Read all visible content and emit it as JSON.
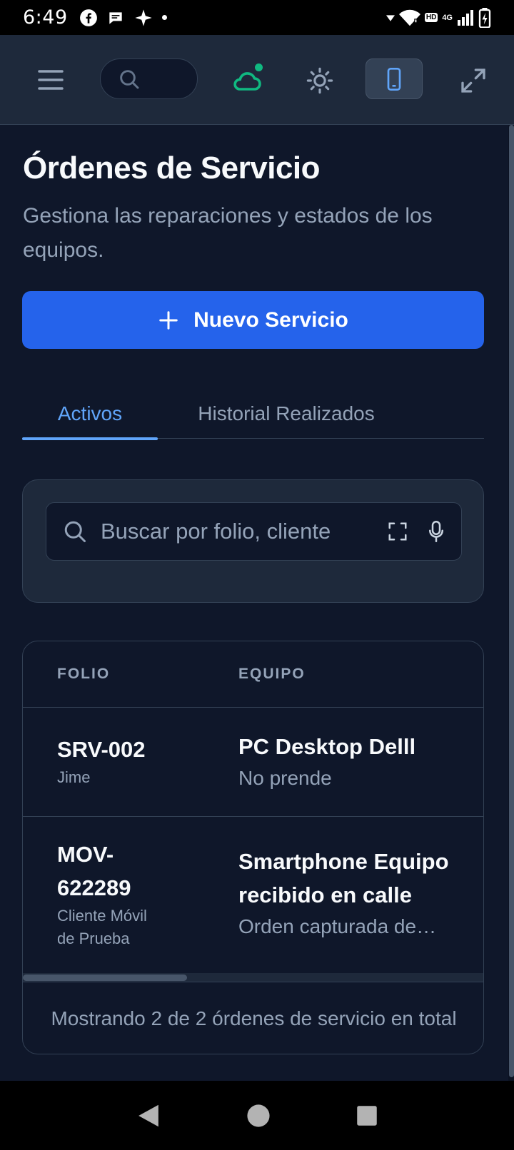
{
  "status_bar": {
    "time": "6:49",
    "network": "4G",
    "hd": "HD"
  },
  "app_bar": {
    "icons": [
      "menu-icon",
      "search-icon",
      "cloud-icon",
      "sun-icon",
      "mobile-icon",
      "expand-icon"
    ],
    "sync_status_color": "#10b981"
  },
  "page": {
    "title": "Órdenes de Servicio",
    "subtitle": "Gestiona las reparaciones y estados de los equipos."
  },
  "new_service_button": {
    "label": "Nuevo Servicio"
  },
  "tabs": [
    {
      "label": "Activos",
      "active": true
    },
    {
      "label": "Historial Realizados",
      "active": false
    }
  ],
  "search": {
    "placeholder": "Buscar por folio, cliente",
    "value": ""
  },
  "table": {
    "headers": [
      "FOLIO",
      "EQUIPO"
    ],
    "rows": [
      {
        "folio": "SRV-002",
        "client": "Jime",
        "equipo": "PC Desktop Delll",
        "description": "No prende"
      },
      {
        "folio": "MOV-622289",
        "client": "Cliente Móvil de Prueba",
        "equipo": "Smartphone Equipo recibido en calle",
        "description": "Orden capturada desde app móvil"
      }
    ],
    "footer": "Mostrando 2 de 2 órdenes de servicio en total"
  },
  "colors": {
    "background": "#0f172a",
    "surface": "#1e293b",
    "accent": "#2563eb",
    "tab_active": "#60a5fa"
  }
}
